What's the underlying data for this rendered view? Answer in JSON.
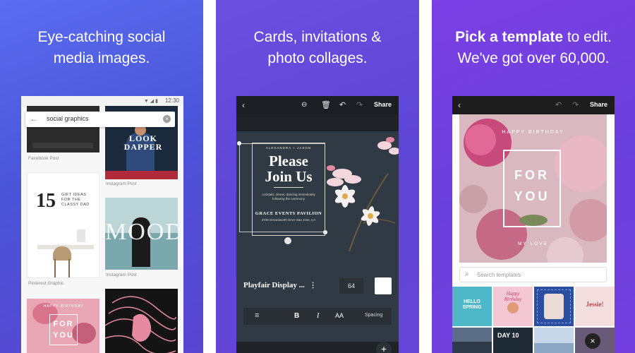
{
  "panels": [
    {
      "caption_line1": "Eye-catching social",
      "caption_line2": "media images."
    },
    {
      "caption_line1": "Cards, invitations &",
      "caption_line2": "photo collages."
    },
    {
      "caption_bold": "Pick a template",
      "caption_rest": " to edit.",
      "caption_line2": "We've got over 60,000."
    }
  ],
  "phone1": {
    "time": "12:30",
    "search_query": "social graphics",
    "tiles": {
      "look_dapper": "LOOK DAPPER",
      "gift_number": "15",
      "gift_text": "GIFT IDEAS FOR THE CLASSY DAD",
      "mood": "MOOD",
      "for_you": "FOR YOU",
      "happy_birthday": "HAPPY BIRTHDAY"
    },
    "labels": {
      "facebook_post": "Facebook Post",
      "instagram_post_1": "Instagram Post",
      "instagram_post_2": "Instagram Post",
      "pinterest_graphic": "Pinterest Graphic"
    }
  },
  "phone2": {
    "share": "Share",
    "invite": {
      "names": "ALEXANDRA + JASON",
      "headline1": "Please",
      "headline2": "Join Us",
      "details": "cocktails, dinner, dancing immediately following the ceremony",
      "venue": "GRACE EVENTS PAVILION",
      "address": "3709 Gerardworth Drive San Jose, CA"
    },
    "font_name": "Playfair Display ...",
    "font_size": "64",
    "format_bold": "B",
    "format_italic": "I",
    "format_case": "AA",
    "format_spacing": "Spacing",
    "add_label": "+"
  },
  "phone3": {
    "share": "Share",
    "card": {
      "happy_birthday": "HAPPY BIRTHDAY",
      "line1": "FOR",
      "line2": "YOU",
      "signoff": "MY LOVE"
    },
    "search_placeholder": "Search templates",
    "thumbnails": [
      "HELLO SPRING",
      "Happy Birthday",
      "",
      "Jessie!",
      "",
      "DAY 10",
      "",
      ""
    ]
  },
  "colors": {
    "panel1": "#4a55d8",
    "panel2": "#5e46d6",
    "panel3": "#6a40dc",
    "editor_dark": "#1f2328",
    "accent_pink": "#e85a7a"
  }
}
